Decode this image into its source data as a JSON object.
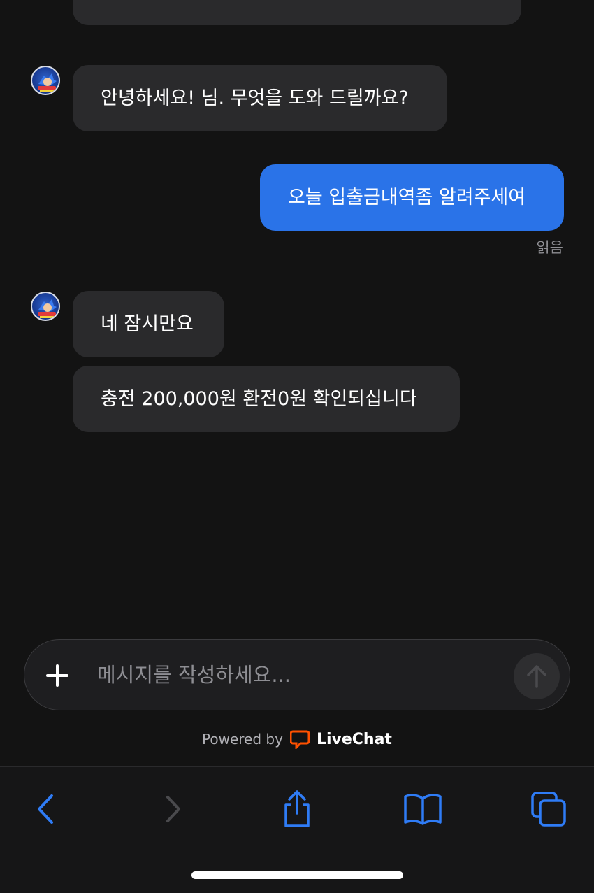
{
  "messages": [
    {
      "from": "agent",
      "text": "안녕하세요! 님. 무엇을 도와 드릴까요?"
    },
    {
      "from": "user",
      "text": "오늘 입출금내역좀 알려주세여"
    },
    {
      "from": "agent",
      "text": "네 잠시만요"
    },
    {
      "from": "agent",
      "text": "충전 200,000원 환전0원 확인되십니다"
    }
  ],
  "read_receipt": "읽음",
  "composer": {
    "placeholder": "메시지를 작성하세요..."
  },
  "footer": {
    "powered_by": "Powered by",
    "brand": "LiveChat"
  },
  "avatar": {
    "icon": "sonic-avatar-icon"
  },
  "colors": {
    "background": "#131313",
    "agent_bubble": "#2a2a2c",
    "user_bubble": "#2a73e8",
    "accent": "#2f7cf6",
    "livechat_orange": "#ff5100"
  },
  "toolbar": {
    "icons": [
      "back-icon",
      "forward-icon",
      "share-icon",
      "bookmarks-icon",
      "tabs-icon"
    ]
  }
}
